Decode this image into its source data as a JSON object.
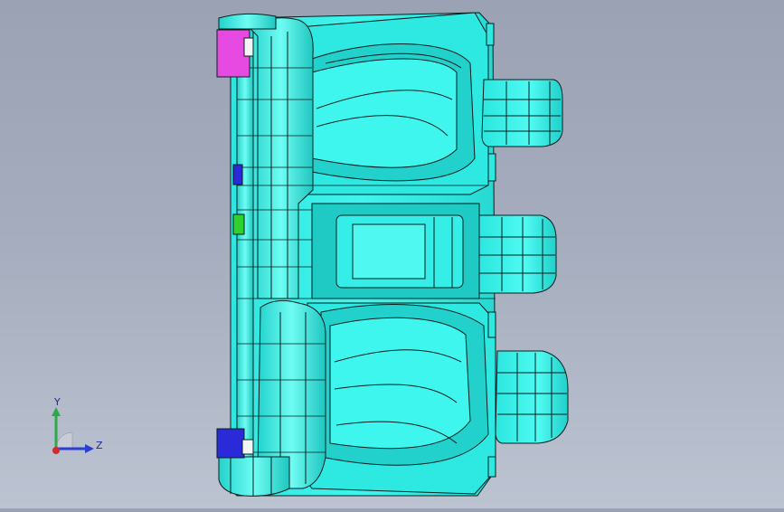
{
  "viewport": {
    "background_top": "#9aa2b4",
    "background_bottom": "#bcc3d1",
    "model": {
      "name": "",
      "body_color": "#2fefe6",
      "edge_color": "#0b1e1e",
      "shade_color": "#18c9c4",
      "highlight_color": "#8cfff6",
      "accent_colors": {
        "pink_part": "#e64ae0",
        "blue_part": "#2a2ad8",
        "green_part": "#2fd12f"
      }
    }
  },
  "triad": {
    "y_label": "Y",
    "z_label": "Z",
    "y_axis_color": "#2ea84a",
    "z_axis_color": "#2a3fd1",
    "x_axis_color": "#d12a2a"
  }
}
